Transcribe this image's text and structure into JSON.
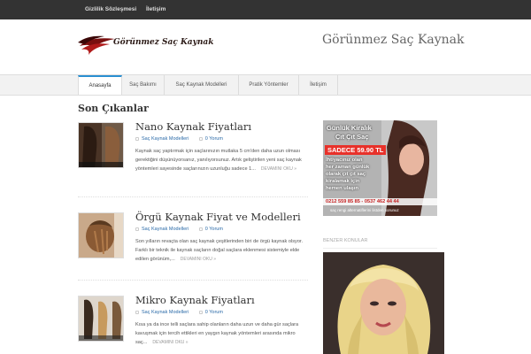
{
  "topbar": {
    "links": [
      "Gizlilik Sözleşmesi",
      "İletişim"
    ]
  },
  "header": {
    "logo_text": "Görünmez Saç Kaynak",
    "site_title": "Görünmez Saç Kaynak"
  },
  "nav": {
    "items": [
      "Anasayfa",
      "Saç Bakımı",
      "Saç Kaynak Modelleri",
      "Pratik Yöntemler",
      "İletişim"
    ],
    "active": "Anasayfa"
  },
  "main": {
    "section_title": "Son Çıkanlar",
    "posts": [
      {
        "title": "Nano Kaynak Fiyatları",
        "category": "Saç Kaynak Modelleri",
        "comments": "0 Yorum",
        "excerpt": "Kaynak saç yaptırmak için saçlarınızın mutlaka 5 cm'den daha uzun olması gerektiğini düşünüyorsanız, yanılıyorsunuz. Artık geliştirilen yeni saç kaynak yöntemleri sayesinde saçlarınızın uzunluğu sadece 1...",
        "readmore": "DEVAMINI OKU »"
      },
      {
        "title": "Örgü Kaynak Fiyat ve Modelleri",
        "category": "Saç Kaynak Modelleri",
        "comments": "0 Yorum",
        "excerpt": "Son yılların revaçta olan saç kaynak çeşitlerinden biri de örgü kaynak olsyor. Farklı bir teknik ile kaynak saçların doğal saçlara eklenmesi sistemiyle elde edilen görünüm,...",
        "readmore": "DEVAMINI OKU »"
      },
      {
        "title": "Mikro Kaynak Fiyatları",
        "category": "Saç Kaynak Modelleri",
        "comments": "0 Yorum",
        "excerpt": "Kısa ya da ince telli saçlara sahip olanların daha uzun ve daha gür saçlara kavuşmak için tercih ettikleri en yaygın kaynak yöntemleri arasında mikro saç...",
        "readmore": "DEVAMINI OKU »"
      }
    ]
  },
  "sidebar": {
    "ad": {
      "line1": "Günlük Kiralık",
      "line2": "Çıt Çıt Saç",
      "price": "SADECE 59.90 TL",
      "body": [
        "İhtiyacınız olan",
        "her zaman günlük",
        "olarak çıt çıt saç",
        "kiralamak için",
        "hemen ulaşın"
      ],
      "phone": "0212 559 85 85 - 0537 462 44 44",
      "footer": "saç rengi alternatiflerini listden sorunuz"
    },
    "widget_title": "BENZER KONULAR"
  },
  "colors": {
    "topbar": "#333333",
    "accent": "#2a8fd1",
    "link": "#2a6aa8",
    "ad_price": "#e8312a"
  }
}
